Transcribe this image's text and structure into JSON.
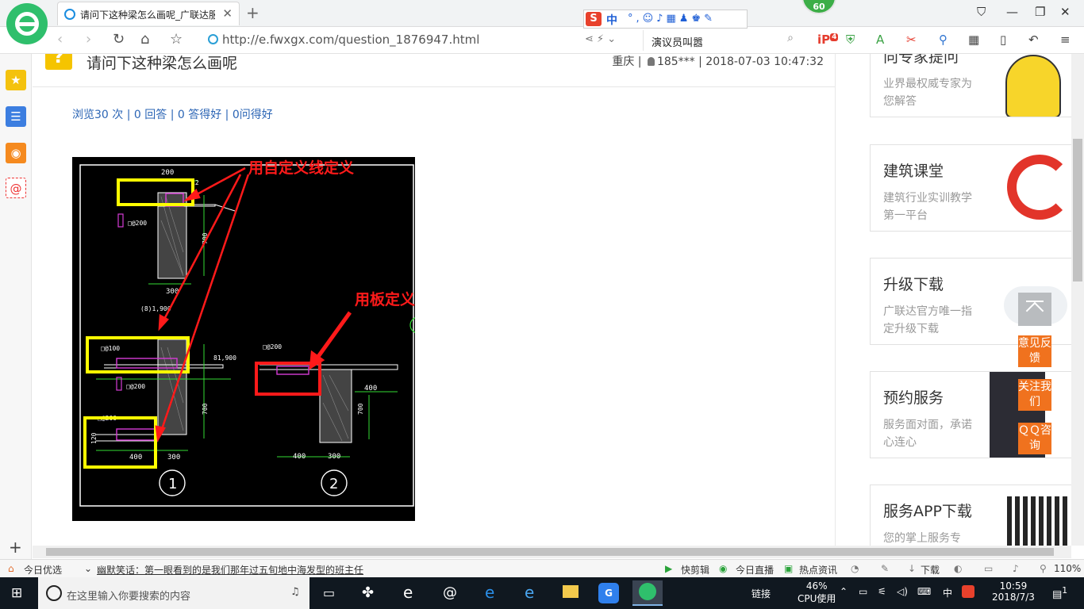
{
  "browser": {
    "tab_title": "请问下这种梁怎么画呢_广联达服",
    "tab_close": "✕",
    "new_tab": "+",
    "url": "http://e.fwxgx.com/question_1876947.html",
    "search_value": "演议员叫嚣",
    "badge": "60",
    "ime_lang": "中",
    "ime_logo": "S",
    "ext_count": "4"
  },
  "question": {
    "title": "请问下这种梁怎么画呢",
    "location": "重庆 |",
    "user": "185***",
    "date": "| 2018-07-03 10:47:32",
    "stats": "浏览30 次 | 0 回答 | 0 答得好 | 0问得好"
  },
  "cad": {
    "label_custom_line": "用自定义线定义",
    "label_slab": "用板定义",
    "dims": {
      "d200": "200",
      "d300": "300",
      "d400": "400",
      "d700": "700",
      "d100": "100",
      "d120": "120",
      "d12": "12",
      "elev": "(8)1,900",
      "elev2": "81,900",
      "rebar200": "□@200",
      "rebar100": "□@100"
    },
    "detail1": "1",
    "detail2": "2"
  },
  "sidebar_cards": [
    {
      "title": "向专家提问",
      "desc": "业界最权威专家为您解答"
    },
    {
      "title": "建筑课堂",
      "desc": "建筑行业实训教学第一平台"
    },
    {
      "title": "升级下载",
      "desc": "广联达官方唯一指定升级下载"
    },
    {
      "title": "预约服务",
      "desc": "服务面对面，承诺心连心"
    },
    {
      "title": "服务APP下载",
      "desc": "您的掌上服务专"
    }
  ],
  "float_buttons": {
    "feedback": "意见反馈",
    "follow": "关注我们",
    "qq": "ＱＱ咨询"
  },
  "statusbar": {
    "today": "今日优选",
    "news": "幽默笑话：第一眼看到的是我们那年过五旬地中海发型的班主任",
    "clip": "快剪辑",
    "live": "今日直播",
    "hot": "热点资讯",
    "download": "下载",
    "zoom": "110%"
  },
  "taskbar": {
    "search_placeholder": "在这里输入你要搜索的内容",
    "link": "链接",
    "cpu_pct": "46%",
    "cpu_label": "CPU使用",
    "ime": "中",
    "time": "10:59",
    "date": "2018/7/3",
    "notif": "1"
  },
  "colors": {
    "accent_green": "#2fbf6c",
    "link_blue": "#2b65b5",
    "float_orange": "#f0721e",
    "annotation_red": "#ff1a1a",
    "highlight_yellow": "#ffff00"
  }
}
